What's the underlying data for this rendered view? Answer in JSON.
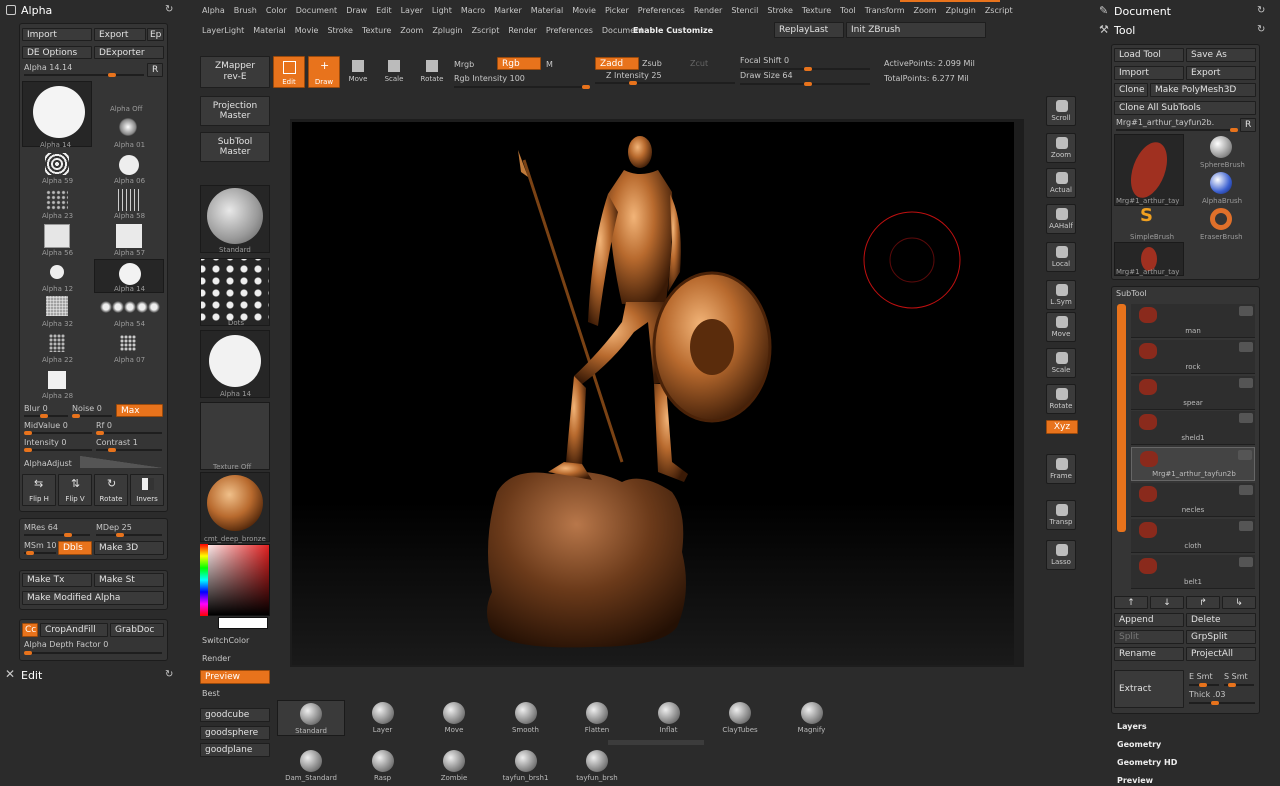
{
  "top_menu": {
    "row1": [
      "Alpha",
      "Brush",
      "Color",
      "Document",
      "Draw",
      "Edit",
      "Layer",
      "Light",
      "Macro",
      "Marker",
      "Material",
      "Movie",
      "Picker",
      "Preferences",
      "Render",
      "Stencil",
      "Stroke",
      "Texture",
      "Tool",
      "Transform",
      "Zoom",
      "Zplugin",
      "Zscript"
    ],
    "row2": [
      "LayerLight",
      "Material",
      "Movie",
      "Stroke",
      "Texture",
      "Zoom",
      "Zplugin",
      "Zscript",
      "Render",
      "Preferences",
      "Document"
    ],
    "enable_customize": "Enable Customize",
    "replay_last": "ReplayLast",
    "init_zbrush": "Init ZBrush"
  },
  "left": {
    "title": "Alpha",
    "import": "Import",
    "export": "Export",
    "ep": "Ep",
    "de_options": "DE Options",
    "dexporter": "DExporter",
    "alpha_value": "Alpha 14.14",
    "r": "R",
    "alpha_off": "Alpha Off",
    "alphas": [
      "Alpha 14",
      "Alpha 01",
      "Alpha 59",
      "Alpha 06",
      "Alpha 23",
      "Alpha 58",
      "Alpha 56",
      "Alpha 57",
      "Alpha 12",
      "Alpha 14",
      "Alpha 32",
      "Alpha 54",
      "Alpha 22",
      "Alpha 07",
      "Alpha 28"
    ],
    "blur": "Blur 0",
    "noise": "Noise 0",
    "max": "Max",
    "midvalue": "MidValue 0",
    "rf": "Rf 0",
    "intensity": "Intensity 0",
    "contrast": "Contrast 1",
    "alpha_adjust": "AlphaAdjust",
    "flip_h": "Flip H",
    "flip_v": "Flip V",
    "rotate": "Rotate",
    "invers": "Invers",
    "mres": "MRes 64",
    "mdep": "MDep 25",
    "msm": "MSm 10",
    "dbls": "Dbls",
    "make3d": "Make 3D",
    "maketx": "Make Tx",
    "makest": "Make St",
    "make_modified": "Make Modified Alpha",
    "cc": "Cc",
    "crop_fill": "CropAndFill",
    "grabdoc": "GrabDoc",
    "depth_factor": "Alpha Depth Factor 0",
    "edit": "Edit"
  },
  "shelf": {
    "zmapper": "ZMapper",
    "zmapper_sub": "rev-E",
    "projection": "Projection",
    "projection_sub": "Master",
    "subtool": "SubTool",
    "subtool_sub": "Master",
    "standard": "Standard",
    "dots": "Dots",
    "alpha14": "Alpha 14",
    "texture_off": "Texture Off",
    "material": "cmt_deep_bronze",
    "switch_color": "SwitchColor",
    "render": "Render",
    "preview": "Preview",
    "best": "Best",
    "goodcube": "goodcube",
    "goodsphere": "goodsphere",
    "goodplane": "goodplane"
  },
  "toolbar": {
    "edit": "Edit",
    "draw": "Draw",
    "move": "Move",
    "scale": "Scale",
    "rotate": "Rotate",
    "mrgb": "Mrgb",
    "rgb": "Rgb",
    "m": "M",
    "rgb_intensity": "Rgb Intensity 100",
    "zadd": "Zadd",
    "zsub": "Zsub",
    "zcut": "Zcut",
    "z_intensity": "Z Intensity 25",
    "focal_shift": "Focal Shift 0",
    "draw_size": "Draw Size 64",
    "active_points": "ActivePoints: 2.099 Mil",
    "total_points": "TotalPoints: 6.277 Mil"
  },
  "right_tools": [
    "Scroll",
    "Zoom",
    "Actual",
    "AAHalf",
    "Local",
    "L.Sym",
    "Move",
    "Scale",
    "Rotate",
    "Xyz",
    "Frame",
    "Transp",
    "Lasso"
  ],
  "brushes_row1": [
    "Standard",
    "Layer",
    "Move",
    "Smooth",
    "Flatten",
    "Inflat",
    "ClayTubes",
    "Magnify"
  ],
  "brushes_row2": [
    "Dam_Standard",
    "Rasp",
    "Zombie",
    "tayfun_brsh1",
    "tayfun_brsh"
  ],
  "tool": {
    "document": "Document",
    "title": "Tool",
    "load": "Load Tool",
    "save": "Save As",
    "import": "Import",
    "export": "Export",
    "clone": "Clone",
    "make_poly": "Make PolyMesh3D",
    "clone_all": "Clone All SubTools",
    "current": "Mrg#1_arthur_tayfun2b.",
    "r": "R",
    "thumbs": [
      "Mrg#1_arthur_tay",
      "SphereBrush",
      "AlphaBrush",
      "SimpleBrush",
      "EraserBrush",
      "Mrg#1_arthur_tay"
    ],
    "subtool_title": "SubTool",
    "subtools": [
      "man",
      "rock",
      "spear",
      "sheld1",
      "Mrg#1_arthur_tayfun2b",
      "necles",
      "cloth",
      "belt1"
    ],
    "append": "Append",
    "delete": "Delete",
    "split": "Split",
    "grpsplit": "GrpSplit",
    "rename": "Rename",
    "projectall": "ProjectAll",
    "extract": "Extract",
    "esmt": "E Smt",
    "ssmt": "S Smt",
    "thick": "Thick .03",
    "sections": [
      "Layers",
      "Geometry",
      "Geometry HD",
      "Preview"
    ]
  },
  "colors": {
    "accent": "#e8731c",
    "bronze": "#b86a2e"
  }
}
